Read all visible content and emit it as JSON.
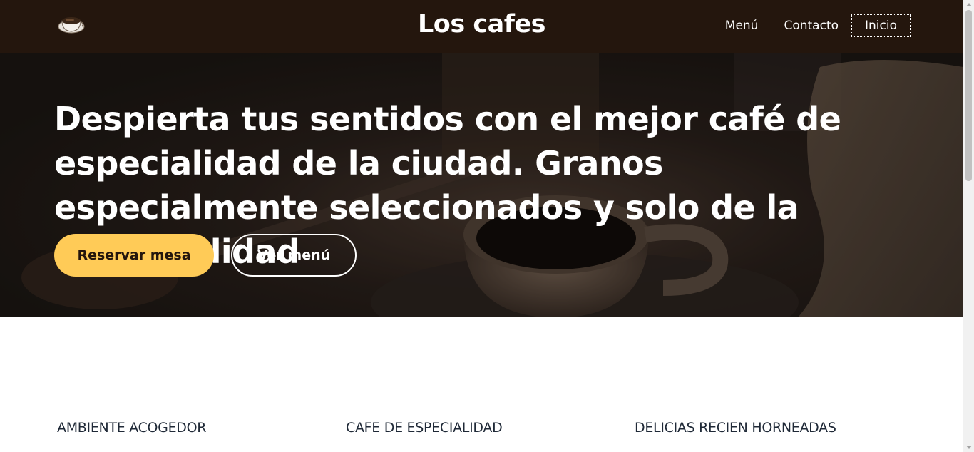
{
  "nav": {
    "site_title": "Los cafes",
    "logo_icon": "coffee-cup-icon",
    "links": [
      {
        "label": "Menú",
        "active": false
      },
      {
        "label": "Contacto",
        "active": false
      },
      {
        "label": "Inicio",
        "active": true
      }
    ]
  },
  "hero": {
    "heading": "Despierta tus sentidos con el mejor café de especialidad de la ciudad. Granos especialmente seleccionados y solo de la mejor calidad",
    "primary_button": "Reservar mesa",
    "secondary_button": "Ver menú"
  },
  "features": [
    {
      "title": "AMBIENTE ACOGEDOR"
    },
    {
      "title": "CAFE DE ESPECIALIDAD"
    },
    {
      "title": "DELICIAS RECIEN HORNEADAS"
    }
  ],
  "colors": {
    "navbar_bg": "#24160d",
    "accent_button": "#ffcb57",
    "feature_text": "#1f2937"
  }
}
